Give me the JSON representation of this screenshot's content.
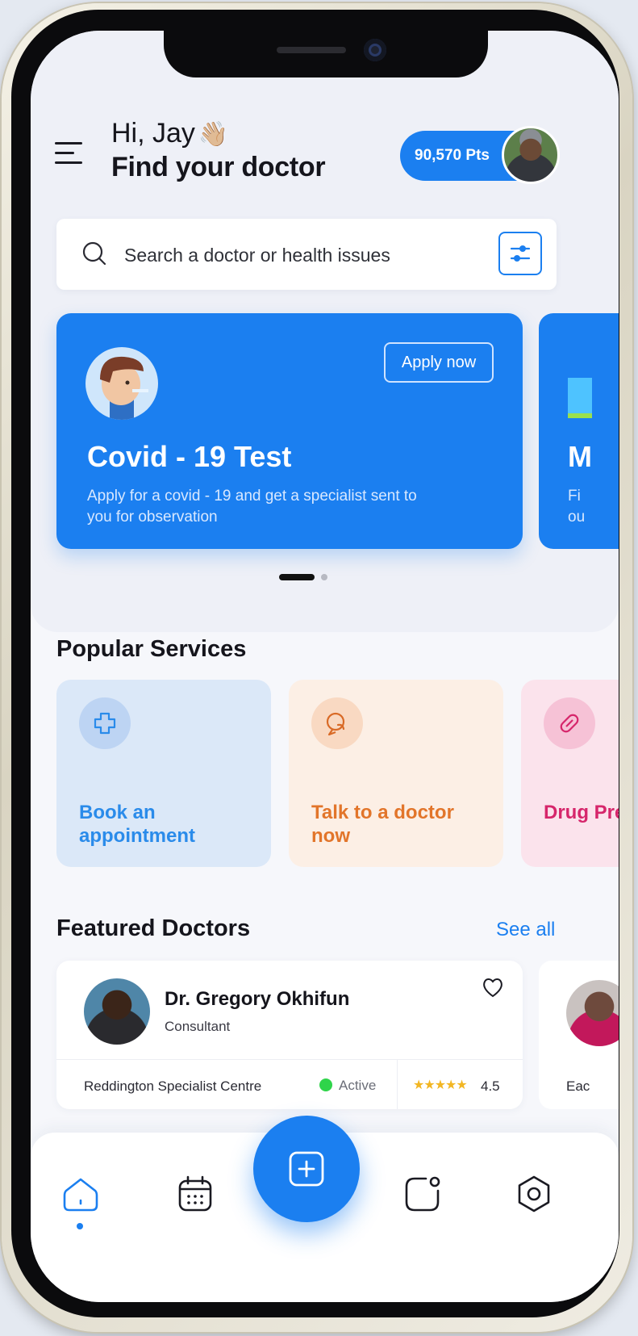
{
  "header": {
    "greeting": "Hi, Jay",
    "wave_emoji": "👋🏼",
    "headline": "Find your doctor",
    "points": "90,570 Pts"
  },
  "search": {
    "placeholder": "Search a doctor or health issues"
  },
  "banner": {
    "title": "Covid - 19 Test",
    "description": "Apply for a covid - 19 and get a specialist sent to you for observation",
    "button_label": "Apply now",
    "next_title": "M",
    "next_description_lines": [
      "Fi",
      "ou"
    ]
  },
  "popular_services": {
    "title": "Popular Services",
    "items": [
      {
        "label": "Book an appointment",
        "icon": "medical-cross-icon",
        "color": "#2a8bea"
      },
      {
        "label": "Talk to a doctor now",
        "icon": "chat-bubbles-icon",
        "color": "#e2752a"
      },
      {
        "label": "Drug Pres",
        "icon": "pill-icon",
        "color": "#d6266b"
      }
    ]
  },
  "featured_doctors": {
    "title": "Featured Doctors",
    "see_all": "See all",
    "doctors": [
      {
        "name": "Dr. Gregory Okhifun",
        "role": "Consultant",
        "centre": "Reddington Specialist Centre",
        "status": "Active",
        "stars": "★★★★★",
        "rating": "4.5"
      },
      {
        "centre": "Eac"
      }
    ]
  },
  "nav": {
    "items": [
      "home-icon",
      "calendar-icon",
      "add-icon",
      "chat-icon",
      "settings-icon"
    ],
    "active": "home-icon"
  },
  "colors": {
    "accent": "#1b7ff0",
    "status_active": "#2fd44a",
    "star": "#f2b623"
  }
}
